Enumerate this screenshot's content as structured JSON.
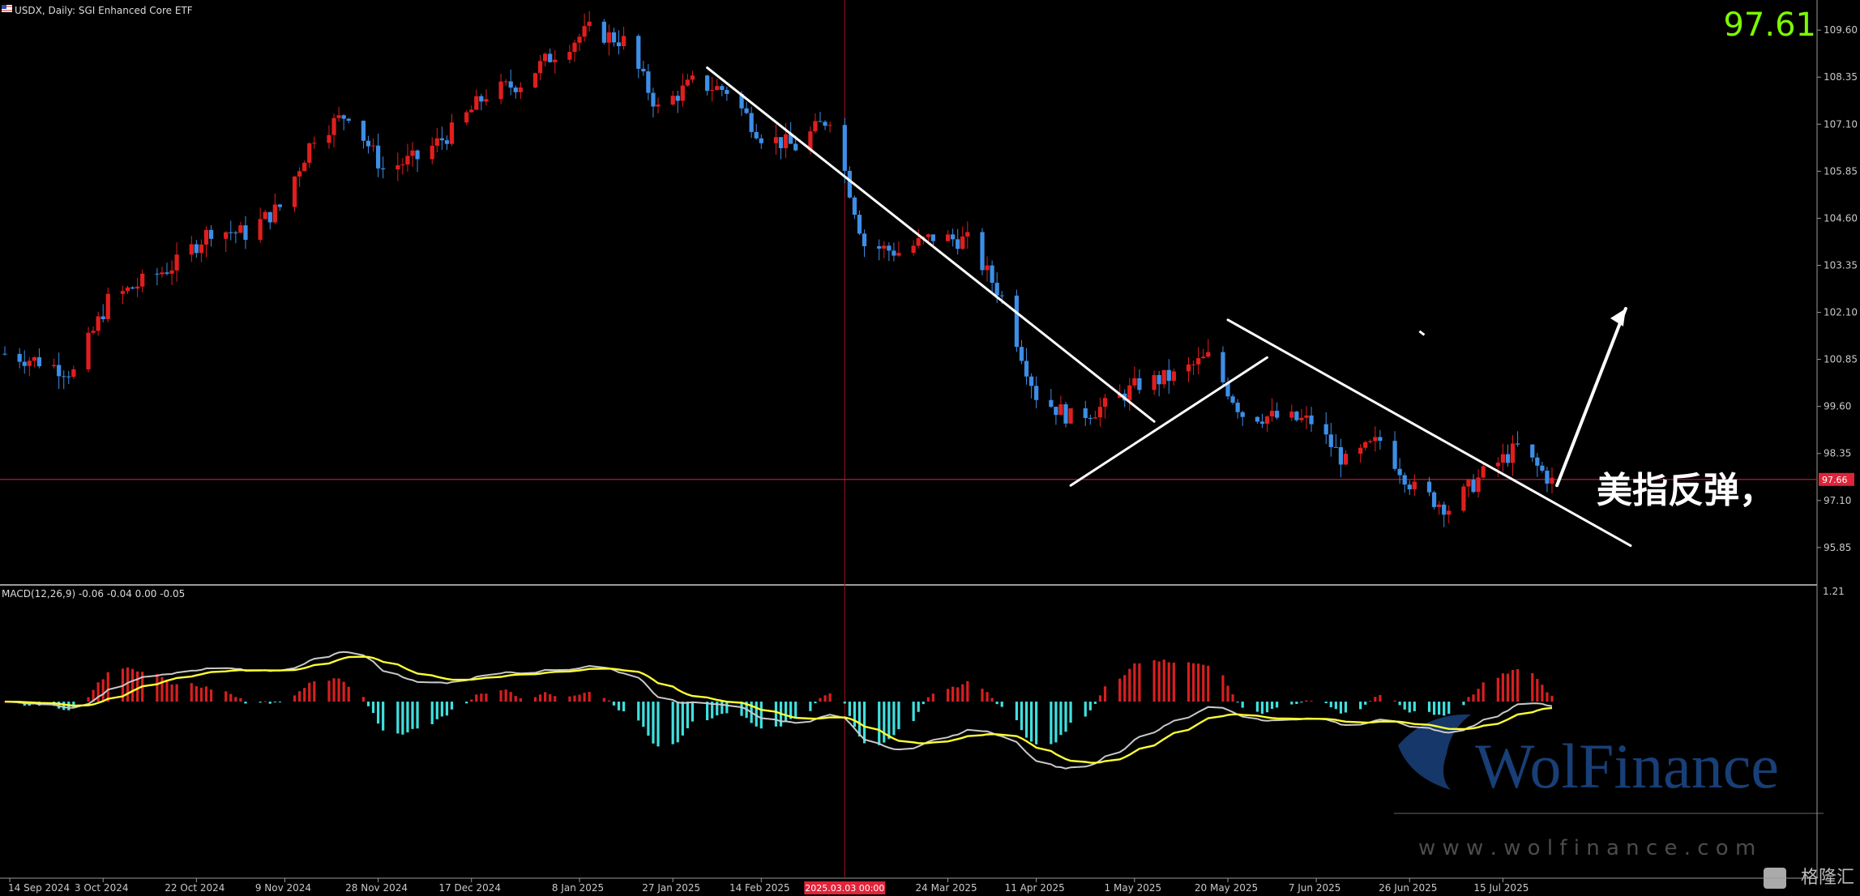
{
  "window": {
    "symbol_title": "USDX, Daily:  SGI Enhanced Core ETF",
    "price_big": "97.61",
    "current_price_tag": "97.66"
  },
  "colors": {
    "background": "#000000",
    "bull": "#e01e1e",
    "bear": "#3d8ee6",
    "axis_text": "#c8c8c8",
    "big_price": "#7cfc00",
    "crosshair": "#a3131a",
    "price_line": "#c0243a",
    "signal_line": "#ffff33",
    "macd_line": "#c9c9c9",
    "hist_pos": "#d81f1f",
    "hist_neg": "#40e0e0",
    "trendline": "#ffffff",
    "watermark": "#1d4a8c"
  },
  "price_axis": {
    "ticks": [
      "109.60",
      "108.35",
      "107.10",
      "105.85",
      "104.60",
      "103.35",
      "102.10",
      "100.85",
      "99.60",
      "98.35",
      "97.10",
      "95.85"
    ],
    "ylim": [
      94.9,
      110.4
    ]
  },
  "time_axis": {
    "labels": [
      "14 Sep 2024",
      "3 Oct 2024",
      "22 Oct 2024",
      "9 Nov 2024",
      "28 Nov 2024",
      "17 Dec 2024",
      "8 Jan 2025",
      "27 Jan 2025",
      "14 Feb 2025",
      "24 Mar 2025",
      "11 Apr 2025",
      "1 May 2025",
      "20 May 2025",
      "7 Jun 2025",
      "26 Jun 2025",
      "15 Jul 2025"
    ],
    "crosshair_date": "2025.03.03 00:00"
  },
  "macd": {
    "label": "MACD(12,26,9) -0.06 -0.04 0.00 -0.05",
    "axis_top": "1.21"
  },
  "annotation": {
    "text": "美指反弹，"
  },
  "watermark": {
    "brand": "WolFinance",
    "url": "w w w . w o l f i n a n c e . c o m",
    "corner_logo": "格隆汇"
  },
  "chart_data": {
    "type": "candlestick",
    "title": "USDX, Daily",
    "series": [
      {
        "name": "USDX",
        "points": [
          {
            "date": "2024-09-13",
            "value": 101.0
          },
          {
            "date": "2024-09-20",
            "value": 100.8
          },
          {
            "date": "2024-09-27",
            "value": 100.5
          },
          {
            "date": "2024-10-04",
            "value": 102.4
          },
          {
            "date": "2024-10-11",
            "value": 102.9
          },
          {
            "date": "2024-10-18",
            "value": 103.4
          },
          {
            "date": "2024-10-25",
            "value": 104.3
          },
          {
            "date": "2024-11-01",
            "value": 104.2
          },
          {
            "date": "2024-11-08",
            "value": 104.9
          },
          {
            "date": "2024-11-15",
            "value": 106.8
          },
          {
            "date": "2024-11-22",
            "value": 107.4
          },
          {
            "date": "2024-11-29",
            "value": 105.9
          },
          {
            "date": "2024-12-06",
            "value": 106.2
          },
          {
            "date": "2024-12-13",
            "value": 106.9
          },
          {
            "date": "2024-12-20",
            "value": 107.9
          },
          {
            "date": "2024-12-27",
            "value": 108.2
          },
          {
            "date": "2025-01-03",
            "value": 109.0
          },
          {
            "date": "2025-01-10",
            "value": 109.6
          },
          {
            "date": "2025-01-17",
            "value": 109.3
          },
          {
            "date": "2025-01-24",
            "value": 107.5
          },
          {
            "date": "2025-01-31",
            "value": 108.2
          },
          {
            "date": "2025-02-07",
            "value": 108.0
          },
          {
            "date": "2025-02-14",
            "value": 106.8
          },
          {
            "date": "2025-02-21",
            "value": 106.5
          },
          {
            "date": "2025-02-28",
            "value": 107.3
          },
          {
            "date": "2025-03-07",
            "value": 103.9
          },
          {
            "date": "2025-03-14",
            "value": 103.7
          },
          {
            "date": "2025-03-21",
            "value": 104.1
          },
          {
            "date": "2025-03-28",
            "value": 104.0
          },
          {
            "date": "2025-04-04",
            "value": 102.5
          },
          {
            "date": "2025-04-11",
            "value": 99.9
          },
          {
            "date": "2025-04-18",
            "value": 99.3
          },
          {
            "date": "2025-04-25",
            "value": 99.6
          },
          {
            "date": "2025-05-02",
            "value": 100.2
          },
          {
            "date": "2025-05-09",
            "value": 100.4
          },
          {
            "date": "2025-05-16",
            "value": 100.9
          },
          {
            "date": "2025-05-23",
            "value": 99.4
          },
          {
            "date": "2025-05-30",
            "value": 99.3
          },
          {
            "date": "2025-06-06",
            "value": 99.2
          },
          {
            "date": "2025-06-13",
            "value": 98.1
          },
          {
            "date": "2025-06-20",
            "value": 98.7
          },
          {
            "date": "2025-06-27",
            "value": 97.4
          },
          {
            "date": "2025-07-04",
            "value": 96.9
          },
          {
            "date": "2025-07-11",
            "value": 97.8
          },
          {
            "date": "2025-07-18",
            "value": 98.5
          },
          {
            "date": "2025-07-25",
            "value": 97.6
          }
        ]
      }
    ],
    "ylim": [
      94.9,
      110.4
    ],
    "macd_ylim": [
      -3.8,
      2.5
    ],
    "grid": false
  }
}
